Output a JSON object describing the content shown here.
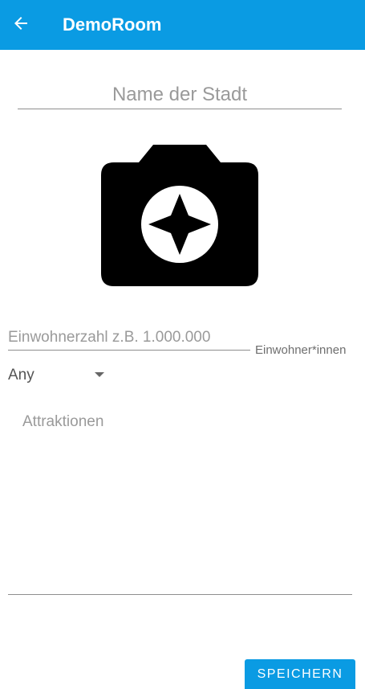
{
  "appbar": {
    "title": "DemoRoom",
    "back_icon": "arrow-back-icon",
    "background": "#0a9be3"
  },
  "form": {
    "city_name": {
      "placeholder": "Name der Stadt",
      "value": ""
    },
    "photo": {
      "icon": "camera-icon"
    },
    "population": {
      "placeholder": "Einwohnerzahl z.B. 1.000.000",
      "value": "",
      "suffix": "Einwohner*innen"
    },
    "dropdown": {
      "selected": "Any"
    },
    "attractions": {
      "placeholder": "Attraktionen",
      "value": ""
    },
    "save_label": "SPEICHERN"
  }
}
